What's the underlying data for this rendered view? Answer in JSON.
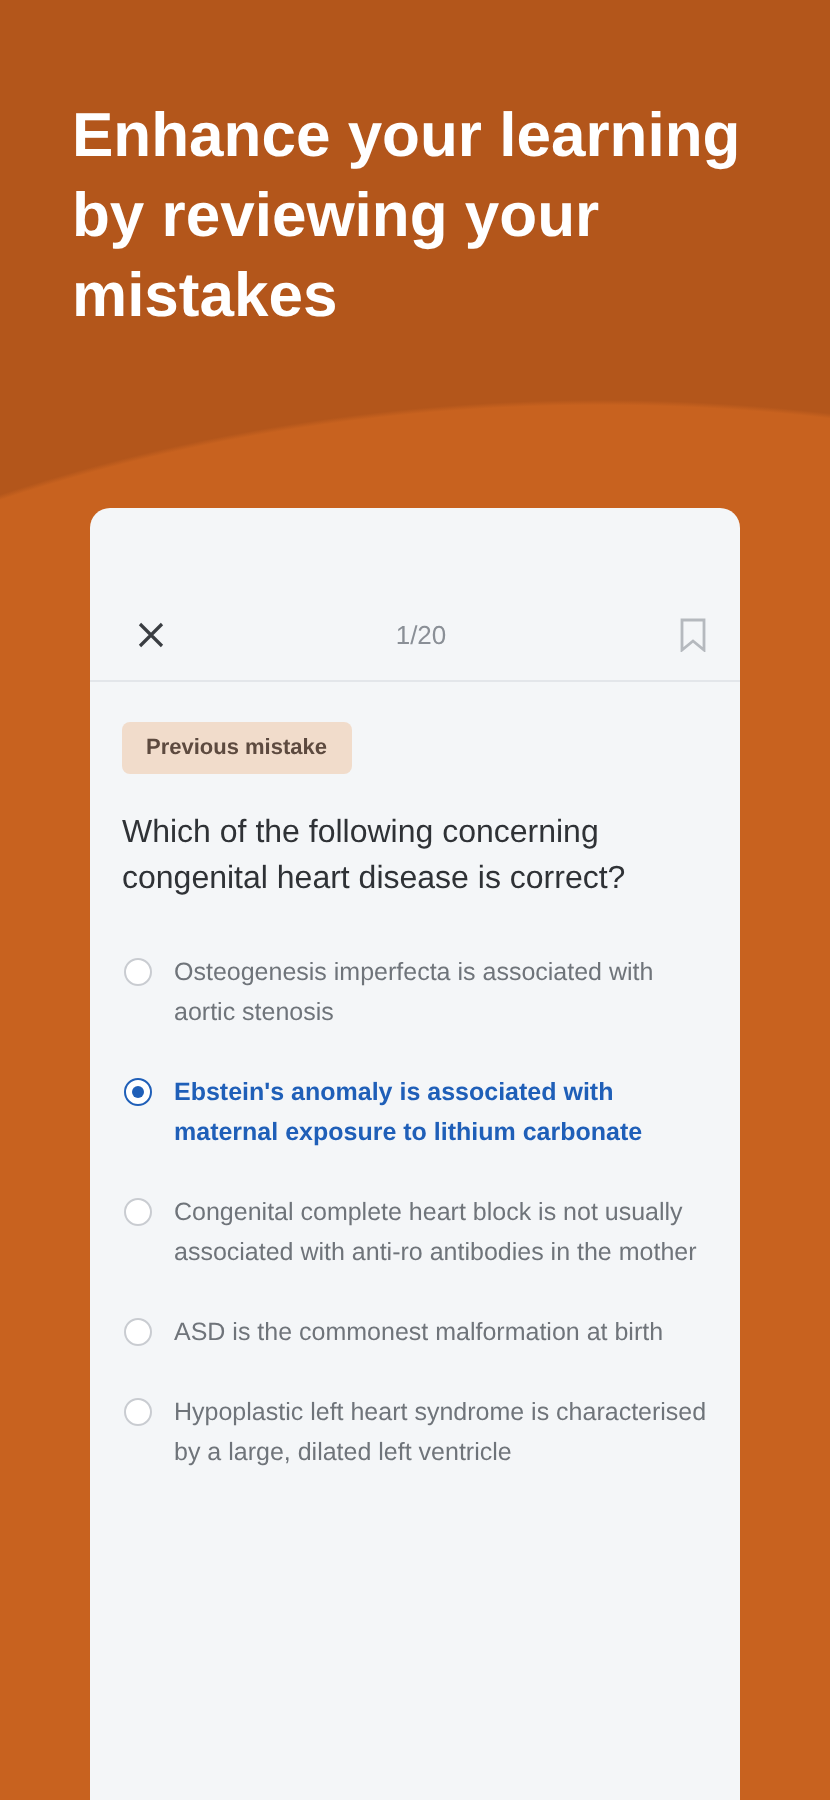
{
  "headline": "Enhance your learning by reviewing your mistakes",
  "quiz": {
    "progress": "1/20",
    "bookmarked": false,
    "badge": "Previous mistake",
    "question": "Which of the following concerning congenital heart disease is correct?",
    "options": [
      {
        "text": "Osteogenesis imperfecta is associated with aortic stenosis",
        "selected": false
      },
      {
        "text": "Ebstein's anomaly is associated with maternal exposure to lithium carbonate",
        "selected": true
      },
      {
        "text": "Congenital complete heart block is not usually associated with anti-ro antibodies in the mother",
        "selected": false
      },
      {
        "text": "ASD is the commonest malformation at birth",
        "selected": false
      },
      {
        "text": "Hypoplastic left heart syndrome is characterised by a large, dilated left ventricle",
        "selected": false
      }
    ]
  }
}
